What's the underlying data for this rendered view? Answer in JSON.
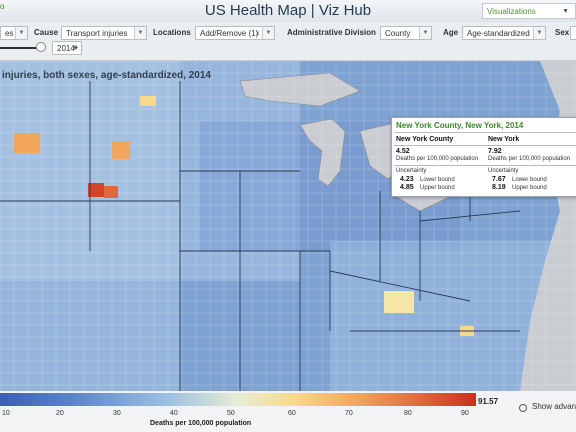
{
  "header": {
    "brand": "o",
    "title": "US Health Map | Viz Hub",
    "visualizations": "Visualizations"
  },
  "toolbar": {
    "first_select": "es",
    "cause_label": "Cause",
    "cause_value": "Transport injuries",
    "locations_label": "Locations",
    "locations_value": "Add/Remove (1)",
    "admin_label": "Administrative Division",
    "admin_value": "County",
    "age_label": "Age",
    "age_value": "Age-standardized",
    "sex_label": "Sex",
    "year_value": "2014"
  },
  "map": {
    "title": "injuries, both sexes, age-standardized, 2014"
  },
  "tooltip": {
    "title": "New York County, New York, 2014",
    "left_head": "New York County",
    "left_value": "4.52",
    "left_sub": "Deaths per 100,000 population",
    "right_head": "New York",
    "right_value": "7.92",
    "right_sub": "Deaths per 100,000 population",
    "uncertainty": "Uncertainty",
    "left_lower": "4.23",
    "left_upper": "4.85",
    "right_lower": "7.67",
    "right_upper": "8.19",
    "lower_label": "Lower bound",
    "upper_label": "Upper bound"
  },
  "legend": {
    "ticks": [
      "10",
      "20",
      "30",
      "40",
      "50",
      "60",
      "70",
      "80",
      "90"
    ],
    "max": "91.57",
    "unit": "Deaths per 100,000 population",
    "advanced": "Show advanc"
  }
}
